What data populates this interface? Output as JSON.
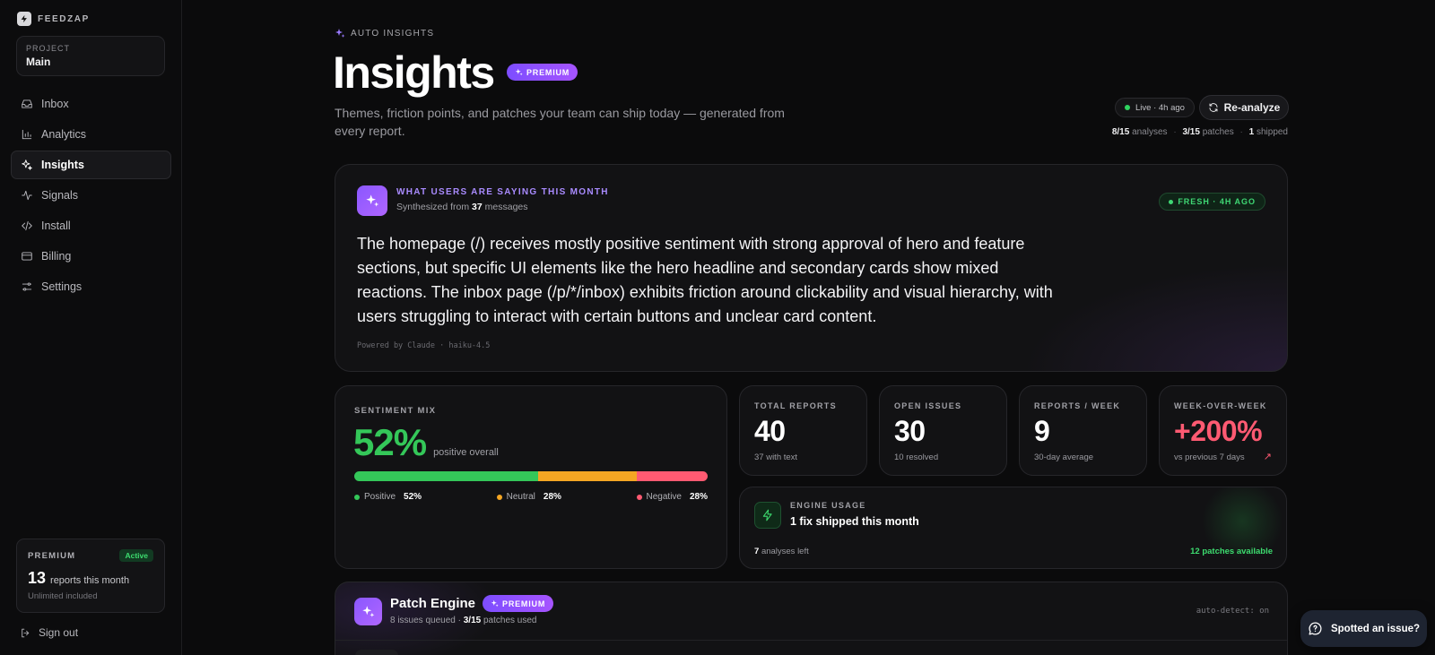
{
  "brand": {
    "name": "FEEDZAP"
  },
  "project": {
    "label": "PROJECT",
    "name": "Main"
  },
  "nav": {
    "items": [
      {
        "label": "Inbox",
        "icon": "inbox-icon"
      },
      {
        "label": "Analytics",
        "icon": "bar-chart-icon"
      },
      {
        "label": "Insights",
        "icon": "sparkles-icon",
        "active": true
      },
      {
        "label": "Signals",
        "icon": "activity-icon"
      },
      {
        "label": "Install",
        "icon": "code-icon"
      },
      {
        "label": "Billing",
        "icon": "credit-card-icon"
      },
      {
        "label": "Settings",
        "icon": "sliders-icon"
      }
    ]
  },
  "plan": {
    "name": "PREMIUM",
    "badge": "Active",
    "count": "13",
    "count_label": "reports this month",
    "sub": "Unlimited included"
  },
  "signout": {
    "label": "Sign out"
  },
  "header": {
    "eyebrow": "AUTO INSIGHTS",
    "title": "Insights",
    "pill": "PREMIUM",
    "subtitle": "Themes, friction points, and patches your team can ship today — generated from every report.",
    "live": "Live · 4h ago",
    "reanalyze": "Re-analyze",
    "stats": {
      "analyses_value": "8/15",
      "analyses_label": "analyses",
      "patches_value": "3/15",
      "patches_label": "patches",
      "shipped_value": "1",
      "shipped_label": "shipped"
    }
  },
  "summary": {
    "kicker": "WHAT USERS ARE SAYING THIS MONTH",
    "sub_prefix": "Synthesized from",
    "sub_count": "37",
    "sub_suffix": "messages",
    "fresh": "FRESH · 4H AGO",
    "body": "The homepage (/) receives mostly positive sentiment with strong approval of hero and feature sections, but specific UI elements like the hero headline and secondary cards show mixed reactions. The inbox page (/p/*/inbox) exhibits friction around clickability and visual hierarchy, with users struggling to interact with certain buttons and unclear card content.",
    "powered": "Powered by Claude · haiku-4.5"
  },
  "sentiment": {
    "kicker": "SENTIMENT MIX",
    "value": "52%",
    "label": "positive overall",
    "segments": [
      {
        "name": "Positive",
        "pct_label": "52%",
        "fraction": 0.52,
        "color": "#34c759"
      },
      {
        "name": "Neutral",
        "pct_label": "28%",
        "fraction": 0.28,
        "color": "#f5a623"
      },
      {
        "name": "Negative",
        "pct_label": "28%",
        "fraction": 0.2,
        "color": "#ff5a72"
      }
    ]
  },
  "metrics": [
    {
      "label": "TOTAL REPORTS",
      "value": "40",
      "sub": "37 with text"
    },
    {
      "label": "OPEN ISSUES",
      "value": "30",
      "sub": "10 resolved"
    },
    {
      "label": "REPORTS / WEEK",
      "value": "9",
      "sub": "30-day average"
    },
    {
      "label": "WEEK-OVER-WEEK",
      "value": "+200%",
      "sub": "vs previous 7 days",
      "arrow": "↗",
      "color": "#ff5a72"
    }
  ],
  "engine": {
    "kicker": "ENGINE USAGE",
    "title": "1 fix shipped this month",
    "left_value": "7",
    "left_label": "analyses left",
    "right": "12 patches available"
  },
  "patch": {
    "title": "Patch Engine",
    "pill": "PREMIUM",
    "sub_prefix": "8 issues queued ·",
    "sub_value": "3/15",
    "sub_suffix": "patches used",
    "autodetect": "auto-detect: on"
  },
  "feedback": {
    "label": "Spotted an issue?"
  },
  "colors": {
    "accent": "#8a57ff",
    "positive": "#34c759",
    "neutral": "#f5a623",
    "negative": "#ff5a72"
  }
}
